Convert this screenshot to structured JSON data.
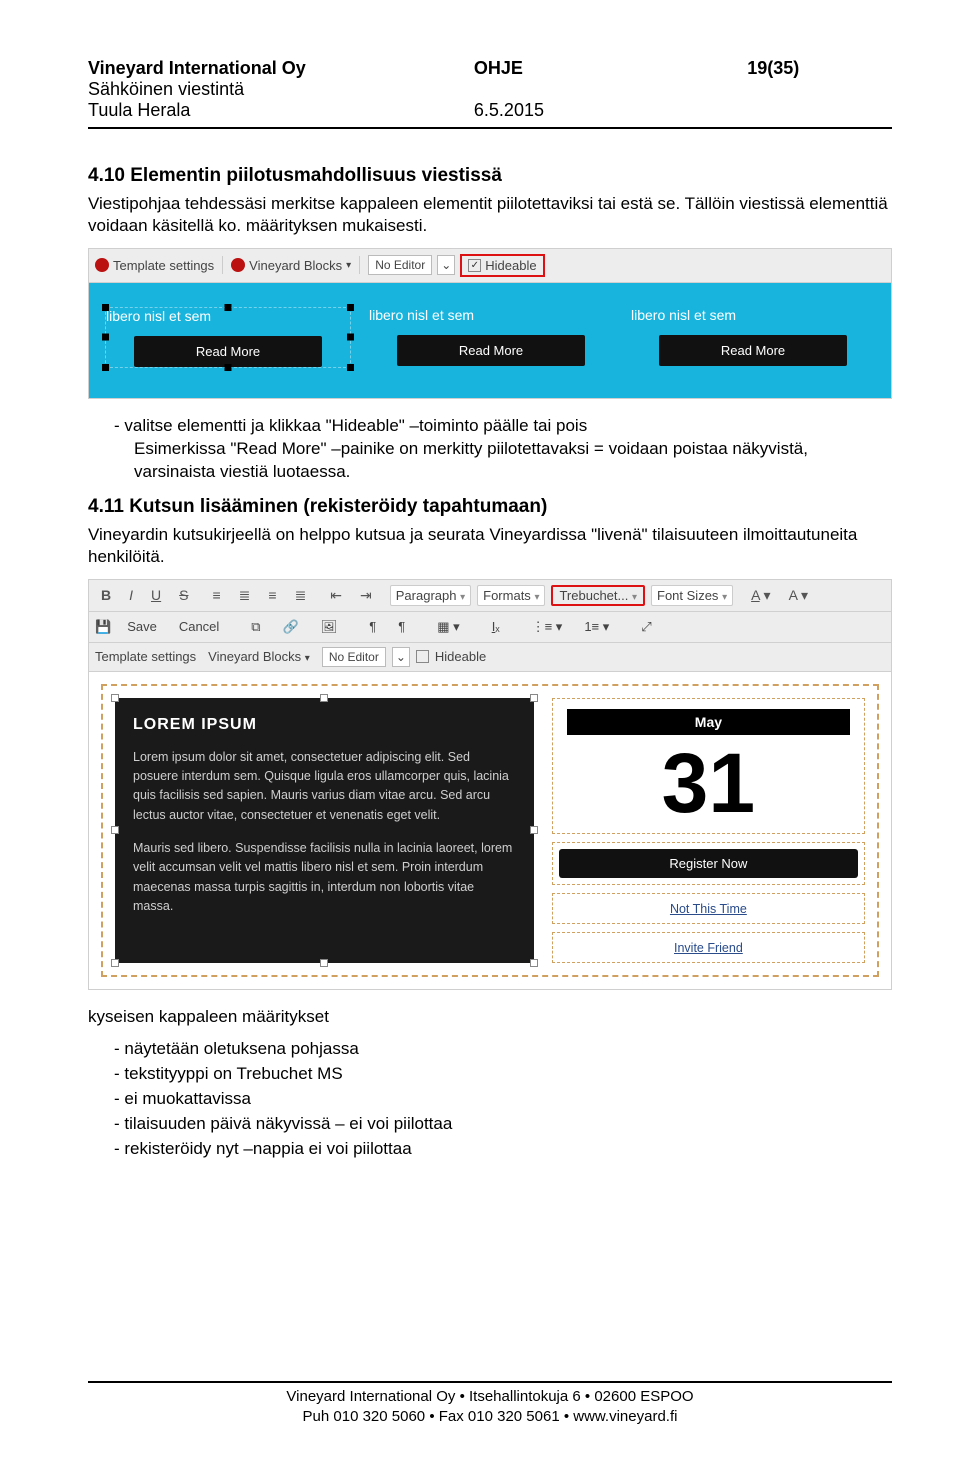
{
  "header": {
    "company": "Vineyard International Oy",
    "doc_type": "OHJE",
    "page_of": "19(35)",
    "dept": "Sähköinen viestintä",
    "author_label": "Tuula Herala",
    "date": "6.5.2015"
  },
  "section1": {
    "title": "4.10 Elementin piilotusmahdollisuus viestissä",
    "para": "Viestipohjaa tehdessäsi merkitse kappaleen elementit piilotettaviksi tai estä se. Tällöin viestissä elementtiä voidaan käsitellä ko. määrityksen mukaisesti."
  },
  "shot1": {
    "template_settings": "Template settings",
    "vineyard_blocks": "Vineyard Blocks",
    "no_editor": "No Editor",
    "hideable": "Hideable",
    "card_label": "libero nisl et sem",
    "read_more": "Read More"
  },
  "bullets1": {
    "b1": "valitse elementti ja klikkaa \"Hideable\" –toiminto päälle tai pois",
    "b1b": "Esimerkissa \"Read More\" –painike on merkitty piilotettavaksi = voidaan poistaa näkyvistä, varsinaista viestiä luotaessa."
  },
  "section2": {
    "title": "4.11 Kutsun lisääminen (rekisteröidy tapahtumaan)",
    "para": "Vineyardin kutsukirjeellä on helppo kutsua ja seurata Vineyardissa \"livenä\" tilaisuuteen ilmoittautuneita henkilöitä."
  },
  "shot2": {
    "row1": {
      "paragraph": "Paragraph",
      "formats": "Formats",
      "trebuchet": "Trebuchet...",
      "font_sizes": "Font Sizes"
    },
    "row2": {
      "save": "Save",
      "cancel": "Cancel"
    },
    "row3": {
      "template_settings": "Template settings",
      "vineyard_blocks": "Vineyard Blocks",
      "no_editor": "No Editor",
      "hideable": "Hideable"
    },
    "lorem": {
      "title": "LOREM IPSUM",
      "p1": "Lorem ipsum dolor sit amet, consectetuer adipiscing elit. Sed posuere interdum sem. Quisque ligula eros ullamcorper quis, lacinia quis facilisis sed sapien. Mauris varius diam vitae arcu. Sed arcu lectus auctor vitae, consectetuer et venenatis eget velit.",
      "p2": "Mauris sed libero. Suspendisse facilisis nulla in lacinia laoreet, lorem velit accumsan velit vel mattis libero nisl et sem. Proin interdum maecenas massa turpis sagittis in, interdum non lobortis vitae massa."
    },
    "cal": {
      "month": "May",
      "day": "31"
    },
    "register": "Register Now",
    "not_this_time": "Not This Time",
    "invite_friend": "Invite Friend"
  },
  "bullets2": {
    "intro": "kyseisen kappaleen määritykset",
    "b1": "näytetään oletuksena pohjassa",
    "b2": "tekstityyppi on Trebuchet MS",
    "b3": "ei muokattavissa",
    "b4": "tilaisuuden päivä näkyvissä – ei voi piilottaa",
    "b5": "rekisteröidy nyt –nappia ei voi piilottaa"
  },
  "footer": {
    "line1": "Vineyard International Oy • Itsehallintokuja 6 • 02600 ESPOO",
    "line2": "Puh 010 320 5060 • Fax 010 320 5061 • www.vineyard.fi"
  }
}
